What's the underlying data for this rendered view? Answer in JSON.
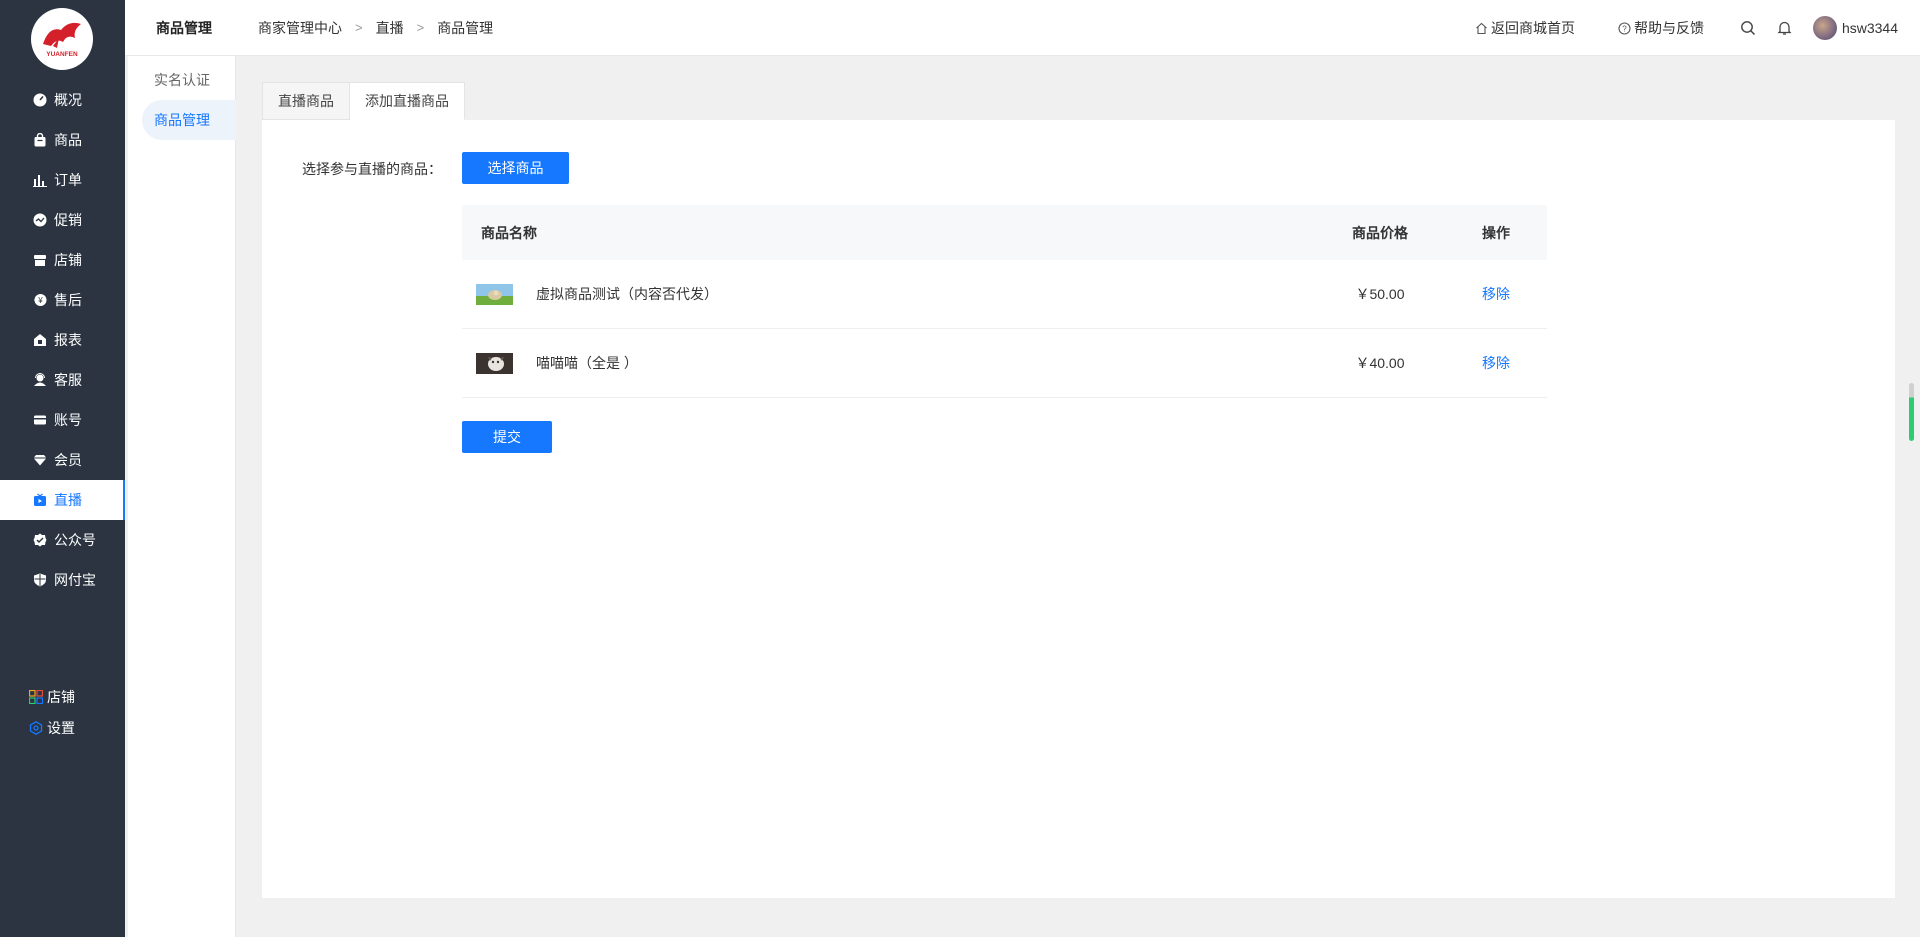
{
  "brand": {
    "logo_text": "YUANFEN",
    "accent": "#1677ff",
    "sidebar_bg": "#2b3440"
  },
  "sidebar": {
    "items": [
      {
        "label": "概况",
        "icon": "dashboard-icon"
      },
      {
        "label": "商品",
        "icon": "bag-icon"
      },
      {
        "label": "订单",
        "icon": "bar-chart-icon"
      },
      {
        "label": "促销",
        "icon": "promotion-icon"
      },
      {
        "label": "店铺",
        "icon": "store-icon"
      },
      {
        "label": "售后",
        "icon": "after-sale-icon"
      },
      {
        "label": "报表",
        "icon": "report-icon"
      },
      {
        "label": "客服",
        "icon": "service-icon"
      },
      {
        "label": "账号",
        "icon": "card-icon"
      },
      {
        "label": "会员",
        "icon": "diamond-icon"
      },
      {
        "label": "直播",
        "icon": "live-icon",
        "active": true
      },
      {
        "label": "公众号",
        "icon": "check-badge-icon"
      },
      {
        "label": "网付宝",
        "icon": "shield-icon"
      }
    ],
    "bottom": [
      {
        "label": "店铺",
        "icon": "grid-icon"
      },
      {
        "label": "设置",
        "icon": "hexagon-settings-icon"
      }
    ]
  },
  "subnav": {
    "items": [
      {
        "label": "实名认证"
      },
      {
        "label": "商品管理",
        "active": true
      }
    ]
  },
  "header": {
    "title": "商品管理",
    "breadcrumb": [
      "商家管理中心",
      "直播",
      "商品管理"
    ],
    "home_link": "返回商城首页",
    "help_link": "帮助与反馈",
    "username": "hsw3344"
  },
  "tabs": [
    {
      "label": "直播商品"
    },
    {
      "label": "添加直播商品",
      "active": true
    }
  ],
  "form": {
    "label": "选择参与直播的商品：",
    "select_button": "选择商品",
    "submit_button": "提交"
  },
  "table": {
    "columns": [
      "商品名称",
      "商品价格",
      "操作"
    ],
    "rows": [
      {
        "name": "虚拟商品测试（内容否代发）",
        "price": "￥50.00",
        "action": "移除"
      },
      {
        "name": "喵喵喵（全是 ）",
        "price": "￥40.00",
        "action": "移除"
      }
    ]
  }
}
